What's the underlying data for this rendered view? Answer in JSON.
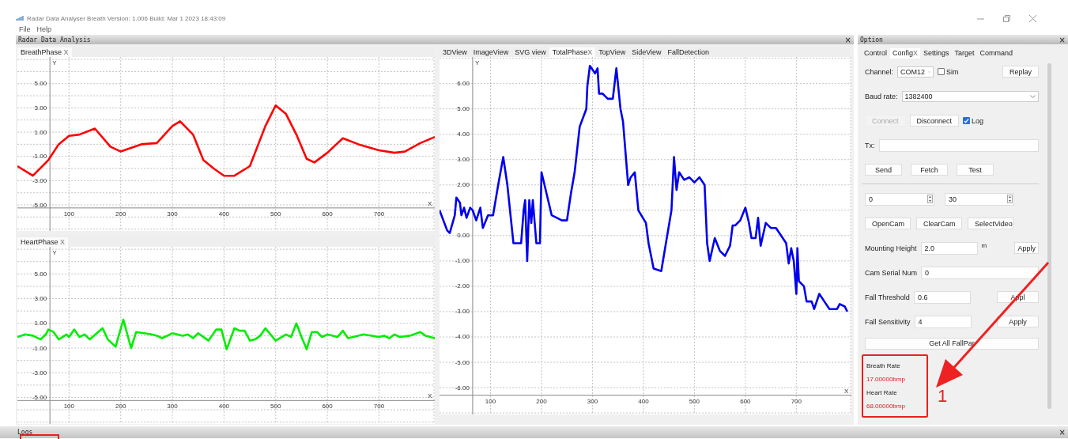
{
  "window": {
    "title": "Radar Data Analyser Breath Version: 1.006 Build: Mar  1 2023 18:43:09"
  },
  "menu": [
    "File",
    "Help"
  ],
  "analysis_dock": {
    "title": "Radar Data Analysis",
    "close": "×",
    "breath_panel": {
      "tab": "BreathPhase",
      "tab_close": "X",
      "chart_data": {
        "type": "line",
        "xlabel": "X",
        "ylabel": "Y",
        "xlim": [
          0,
          808
        ],
        "ylim": [
          -7.15,
          7.2
        ],
        "grid": true,
        "xticks": [
          100,
          200,
          300,
          400,
          500,
          600,
          700
        ],
        "yticks": [
          {
            "value": 5,
            "label": "5.00"
          },
          {
            "value": 3,
            "label": "3.00"
          },
          {
            "value": 1,
            "label": "1.00"
          },
          {
            "value": -1,
            "label": "-1.00"
          },
          {
            "value": -3,
            "label": "-3.00"
          },
          {
            "value": -5,
            "label": "-5.00"
          }
        ],
        "x": [
          0,
          30,
          60,
          80,
          100,
          120,
          150,
          180,
          200,
          240,
          270,
          300,
          315,
          340,
          360,
          380,
          400,
          420,
          450,
          480,
          500,
          520,
          540,
          560,
          575,
          600,
          630,
          660,
          700,
          730,
          750,
          780,
          808
        ],
        "series": [
          {
            "color": "#ff0000",
            "values": [
              -1.8,
              -2.6,
              -1.3,
              0,
              0.7,
              0.8,
              1.3,
              -0.2,
              -0.6,
              0,
              0.1,
              1.5,
              1.9,
              0.8,
              -1.3,
              -2,
              -2.6,
              -2.6,
              -1.8,
              1.5,
              3.2,
              2.5,
              0.8,
              -1.2,
              -1.5,
              -0.7,
              0.5,
              0,
              -0.5,
              -0.7,
              -0.6,
              0.1,
              0.6
            ]
          }
        ]
      }
    },
    "heart_panel": {
      "tab": "HeartPhase",
      "tab_close": "X",
      "chart_data": {
        "type": "line",
        "xlabel": "X",
        "ylabel": "Y",
        "xlim": [
          0,
          808
        ],
        "ylim": [
          -7.15,
          7.2
        ],
        "grid": true,
        "xticks": [
          100,
          200,
          300,
          400,
          500,
          600,
          700
        ],
        "yticks": [
          {
            "value": 5,
            "label": "5.00"
          },
          {
            "value": 3,
            "label": "3.00"
          },
          {
            "value": 1,
            "label": "1.00"
          },
          {
            "value": -1,
            "label": "-1.00"
          },
          {
            "value": -3,
            "label": "-3.00"
          },
          {
            "value": -5,
            "label": "-5.00"
          }
        ],
        "x": [
          0,
          15,
          30,
          45,
          55,
          60,
          70,
          80,
          95,
          100,
          110,
          120,
          130,
          140,
          165,
          175,
          190,
          205,
          220,
          230,
          260,
          270,
          280,
          300,
          320,
          330,
          340,
          350,
          370,
          385,
          395,
          405,
          420,
          430,
          440,
          450,
          460,
          470,
          480,
          500,
          520,
          530,
          540,
          550,
          560,
          570,
          580,
          590,
          600,
          620,
          630,
          640,
          650,
          670,
          700,
          710,
          720,
          730,
          740,
          760,
          780,
          790,
          808
        ],
        "series": [
          {
            "color": "#00ee00",
            "values": [
              -0.1,
              0.1,
              0,
              -0.3,
              0.1,
              0.5,
              0.3,
              -0.3,
              0.1,
              -0.1,
              0.5,
              -0.1,
              0.1,
              -0.3,
              0.6,
              -0.3,
              -0.9,
              1.3,
              -1.0,
              0.3,
              0.1,
              0,
              -0.2,
              0.2,
              0,
              0.1,
              -0.2,
              0.2,
              -0.4,
              0.5,
              0.5,
              -1.1,
              0.6,
              0.4,
              0.4,
              -0.4,
              -0.3,
              0,
              0.6,
              -0.4,
              0.1,
              -0.1,
              1.0,
              -0.1,
              -1.1,
              0.3,
              0.3,
              -0.1,
              0.1,
              -0.1,
              0.4,
              -0.2,
              -0.1,
              0.1,
              -0.1,
              0,
              -0.2,
              0.1,
              -0.1,
              0,
              0.3,
              0,
              -0.2
            ]
          }
        ]
      }
    },
    "view_tabs": [
      {
        "label": "3DView",
        "selected": false
      },
      {
        "label": "ImageView",
        "selected": false
      },
      {
        "label": "SVG view",
        "selected": false
      },
      {
        "label": "TotalPhase",
        "selected": true,
        "close": "X"
      },
      {
        "label": "TopView",
        "selected": false
      },
      {
        "label": "SideView",
        "selected": false
      },
      {
        "label": "FallDetection",
        "selected": false
      }
    ],
    "total_panel": {
      "chart_data": {
        "type": "line",
        "xlabel": "X",
        "ylabel": "Y",
        "xlim": [
          0,
          808
        ],
        "ylim": [
          -7.06,
          7.05
        ],
        "grid": true,
        "xticks": [
          100,
          200,
          300,
          400,
          500,
          600,
          700
        ],
        "yticks": [
          {
            "value": 6,
            "label": "6.00"
          },
          {
            "value": 5,
            "label": "5.00"
          },
          {
            "value": 4,
            "label": "4.00"
          },
          {
            "value": 3,
            "label": "3.00"
          },
          {
            "value": 2,
            "label": "2.00"
          },
          {
            "value": 0,
            "label": "0.00"
          },
          {
            "value": -1,
            "label": "-1.00"
          },
          {
            "value": -2,
            "label": "-2.00"
          },
          {
            "value": -3,
            "label": "-3.00"
          },
          {
            "value": -4,
            "label": "-4.00"
          },
          {
            "value": -5,
            "label": "-5.00"
          },
          {
            "value": -6,
            "label": "-6.00"
          }
        ],
        "x": [
          0,
          15,
          20,
          30,
          33,
          40,
          43,
          48,
          53,
          60,
          65,
          72,
          80,
          85,
          95,
          105,
          115,
          125,
          133,
          145,
          160,
          165,
          168,
          172,
          176,
          180,
          183,
          190,
          197,
          200,
          220,
          240,
          250,
          258,
          265,
          275,
          288,
          290,
          295,
          305,
          310,
          313,
          320,
          330,
          340,
          347,
          355,
          360,
          370,
          375,
          383,
          390,
          405,
          410,
          420,
          435,
          445,
          455,
          460,
          465,
          470,
          480,
          490,
          500,
          510,
          520,
          525,
          530,
          540,
          550,
          560,
          570,
          575,
          580,
          590,
          600,
          607,
          612,
          620,
          625,
          630,
          640,
          650,
          660,
          670,
          680,
          685,
          690,
          695,
          700,
          702,
          705,
          715,
          720,
          730,
          735,
          745,
          755,
          765,
          780,
          785,
          795,
          800
        ],
        "series": [
          {
            "color": "#0000ee",
            "values": [
              1.0,
              0.2,
              0.1,
              0.8,
              1.5,
              1.3,
              0.8,
              1.1,
              0.7,
              1.1,
              1.0,
              0.6,
              1.1,
              0.3,
              0.8,
              0.8,
              2.0,
              3.1,
              2.0,
              -0.3,
              -0.3,
              1.0,
              1.4,
              -1.0,
              1.4,
              0.5,
              1.4,
              -0.3,
              -0.3,
              2.5,
              0.8,
              0.6,
              0.6,
              1.7,
              2.5,
              4.3,
              5.0,
              5.9,
              6.7,
              6.4,
              6.6,
              5.6,
              5.6,
              5.4,
              5.4,
              6.6,
              5.0,
              4.5,
              2.0,
              2.3,
              2.5,
              1.0,
              0.5,
              -0.3,
              -1.3,
              -1.4,
              -0.2,
              1.0,
              3.1,
              1.8,
              2.5,
              2.2,
              2.3,
              2.1,
              2.3,
              2.0,
              -0.3,
              -1.0,
              -0.1,
              -0.6,
              -0.8,
              -0.4,
              0.4,
              0.4,
              0.6,
              1.1,
              0.5,
              -0.1,
              -0.1,
              0.7,
              -0.4,
              0.5,
              0.3,
              0.3,
              0.0,
              -0.3,
              -1.1,
              -0.5,
              -1.0,
              -2.3,
              -0.5,
              -1.8,
              -2.0,
              -2.6,
              -2.6,
              -2.9,
              -2.3,
              -2.6,
              -2.9,
              -2.9,
              -2.7,
              -2.8,
              -3.0
            ]
          }
        ]
      }
    }
  },
  "option_dock": {
    "title": "Option",
    "close": "×",
    "tabs": [
      {
        "label": "Control",
        "selected": false
      },
      {
        "label": "Config",
        "selected": true,
        "close": "X"
      },
      {
        "label": "Settings",
        "selected": false
      },
      {
        "label": "Target",
        "selected": false
      },
      {
        "label": "Command",
        "selected": false
      }
    ],
    "channel": {
      "label": "Channel:",
      "value": "COM12"
    },
    "sim": {
      "label": "Sim",
      "checked": false
    },
    "replay": "Replay",
    "baud": {
      "label": "Baud rate:",
      "value": "1382400"
    },
    "connect": {
      "label": "Connect",
      "disabled": true
    },
    "disconnect": {
      "label": "Disconnect",
      "disabled": false
    },
    "log": {
      "label": "Log",
      "checked": true
    },
    "tx": {
      "label": "Tx:"
    },
    "action_buttons": [
      "Send",
      "Fetch",
      "Test"
    ],
    "spinners": [
      "0",
      "30"
    ],
    "cam_buttons": [
      "OpenCam",
      "ClearCam",
      "SelectVideo"
    ],
    "fields": [
      {
        "label": "Mounting Height",
        "value": "2.0",
        "unit": "m",
        "button": "Apply",
        "kind": "narrow"
      },
      {
        "label": "Cam Serial Num",
        "value": "0",
        "kind": "wide"
      },
      {
        "label": "Fall Threshold",
        "value": "0.6",
        "button": "Appl",
        "kind": "narrow"
      },
      {
        "label": "Fall Sensitivity",
        "value": "4",
        "button": "Apply",
        "kind": "narrow"
      }
    ],
    "get_all": "Get All FallPar",
    "rates": [
      {
        "label": "Breath Rate",
        "value": "17.00000bmp"
      },
      {
        "label": "Heart Rate",
        "value": "68.00000bmp"
      }
    ]
  },
  "annotation": {
    "label": "1"
  },
  "logs_dock": {
    "title": "Logs",
    "close": "×"
  }
}
